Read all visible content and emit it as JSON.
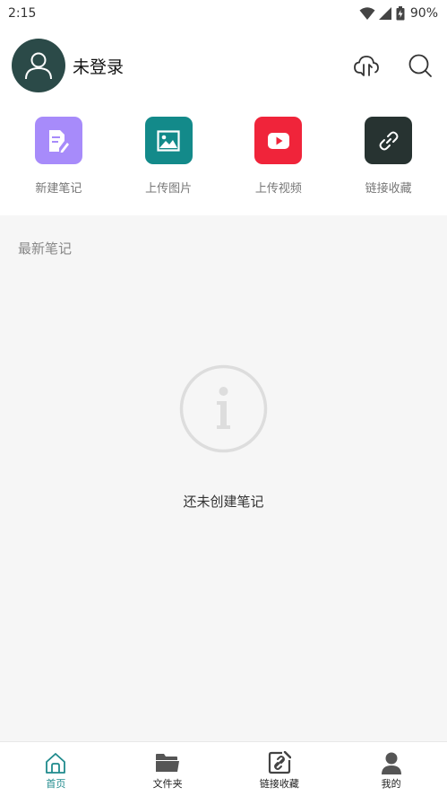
{
  "status_bar": {
    "time": "2:15",
    "battery": "90%"
  },
  "header": {
    "login_label": "未登录"
  },
  "quick_actions": [
    {
      "label": "新建笔记",
      "color": "#a78bfa",
      "icon": "note-edit-icon"
    },
    {
      "label": "上传图片",
      "color": "#138a8a",
      "icon": "image-icon"
    },
    {
      "label": "上传视频",
      "color": "#f0243a",
      "icon": "play-icon"
    },
    {
      "label": "链接收藏",
      "color": "#273331",
      "icon": "link-icon"
    }
  ],
  "content": {
    "section_title": "最新笔记",
    "empty_text": "还未创建笔记"
  },
  "bottom_nav": [
    {
      "label": "首页",
      "active": true,
      "icon": "home-icon"
    },
    {
      "label": "文件夹",
      "active": false,
      "icon": "folder-icon"
    },
    {
      "label": "链接收藏",
      "active": false,
      "icon": "link-edit-icon"
    },
    {
      "label": "我的",
      "active": false,
      "icon": "user-icon"
    }
  ],
  "colors": {
    "accent": "#1f8a8c",
    "avatar_bg": "#2b4a48",
    "content_bg": "#f6f6f6"
  }
}
